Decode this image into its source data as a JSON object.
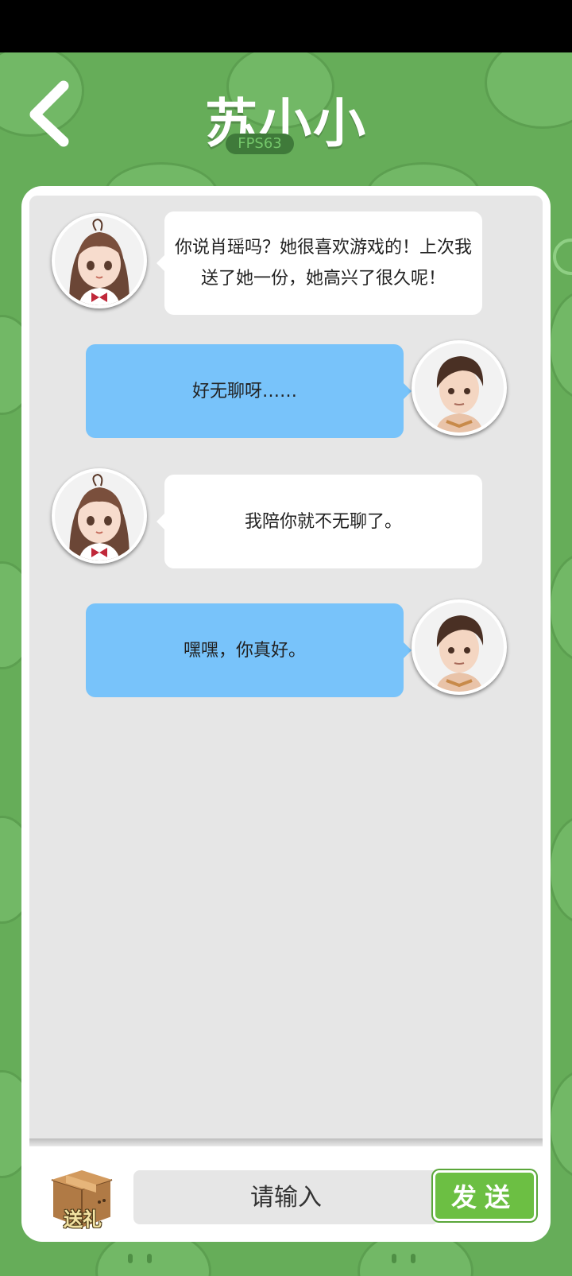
{
  "header": {
    "title": "苏小小",
    "fps": "FPS63"
  },
  "messages": [
    {
      "sender": "npc",
      "text": "你说肖瑶吗？她很喜欢游戏的！上次我送了她一份，她高兴了很久呢！"
    },
    {
      "sender": "player",
      "text": "好无聊呀……"
    },
    {
      "sender": "npc",
      "text": "我陪你就不无聊了。"
    },
    {
      "sender": "player",
      "text": "嘿嘿，你真好。"
    }
  ],
  "footer": {
    "gift_label": "送礼",
    "input_placeholder": "请输入",
    "send_label": "发送"
  },
  "colors": {
    "background": "#66ad59",
    "player_bubble": "#78c3fa",
    "npc_bubble": "#ffffff",
    "send_button": "#6cbf43"
  },
  "icons": {
    "back": "chevron-left-icon",
    "gift": "gift-box-icon"
  }
}
